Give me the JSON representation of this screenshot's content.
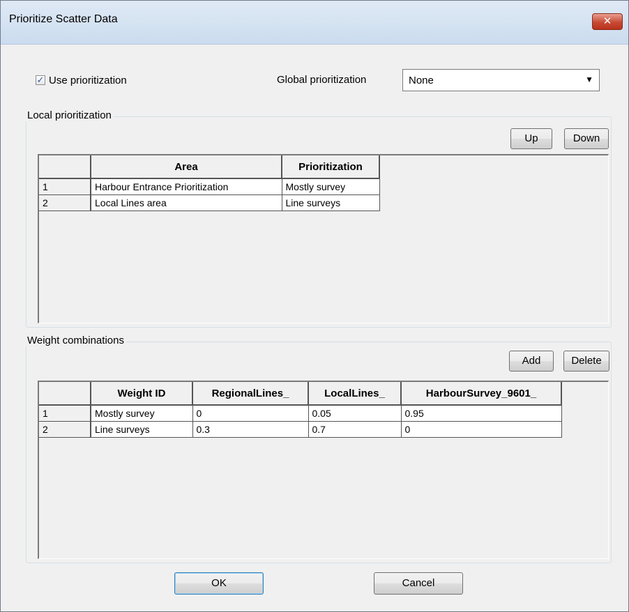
{
  "window": {
    "title": "Prioritize Scatter Data",
    "close_glyph": "✕"
  },
  "use_prioritization": {
    "label": "Use prioritization",
    "checked": true
  },
  "global_prioritization": {
    "label": "Global prioritization",
    "value": "None"
  },
  "local": {
    "title": "Local prioritization",
    "up_label": "Up",
    "down_label": "Down",
    "headers": [
      "",
      "Area",
      "Prioritization"
    ],
    "rows": [
      [
        "1",
        "Harbour Entrance Prioritization",
        "Mostly survey"
      ],
      [
        "2",
        "Local Lines area",
        "Line surveys"
      ]
    ]
  },
  "weights": {
    "title": "Weight combinations",
    "add_label": "Add",
    "delete_label": "Delete",
    "headers": [
      "",
      "Weight ID",
      "RegionalLines_",
      "LocalLines_",
      "HarbourSurvey_9601_"
    ],
    "rows": [
      [
        "1",
        "Mostly survey",
        "0",
        "0.05",
        "0.95"
      ],
      [
        "2",
        "Line surveys",
        "0.3",
        "0.7",
        "0"
      ]
    ]
  },
  "footer": {
    "ok_label": "OK",
    "cancel_label": "Cancel"
  },
  "colors": {
    "titlebar": "#d5e3f2",
    "close": "#c84a33",
    "panel": "#f0f0f0"
  }
}
